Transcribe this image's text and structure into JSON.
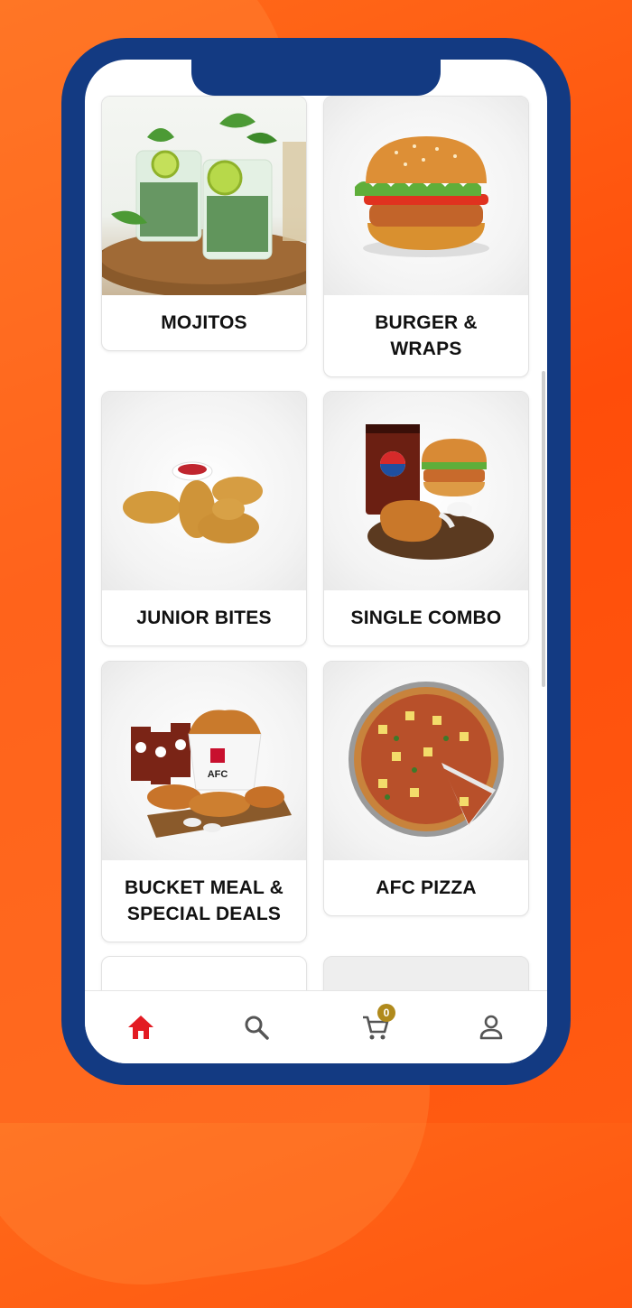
{
  "categories": [
    {
      "label": "MOJITOS"
    },
    {
      "label": "BURGER &\nWRAPS"
    },
    {
      "label": "JUNIOR BITES"
    },
    {
      "label": "SINGLE COMBO"
    },
    {
      "label": "BUCKET MEAL  &\nSPECIAL  DEALS"
    },
    {
      "label": "AFC PIZZA"
    }
  ],
  "bucket_text": "AFC",
  "tabbar": {
    "tabs": [
      {
        "name": "home",
        "icon": "home-icon",
        "active": true
      },
      {
        "name": "search",
        "icon": "search-icon",
        "active": false
      },
      {
        "name": "cart",
        "icon": "cart-icon",
        "active": false
      },
      {
        "name": "account",
        "icon": "user-icon",
        "active": false
      }
    ],
    "cart_count": "0"
  },
  "colors": {
    "accent": "#e31b23",
    "frame": "#133a82",
    "badge": "#b08a1c",
    "background": "#ff5a12"
  }
}
